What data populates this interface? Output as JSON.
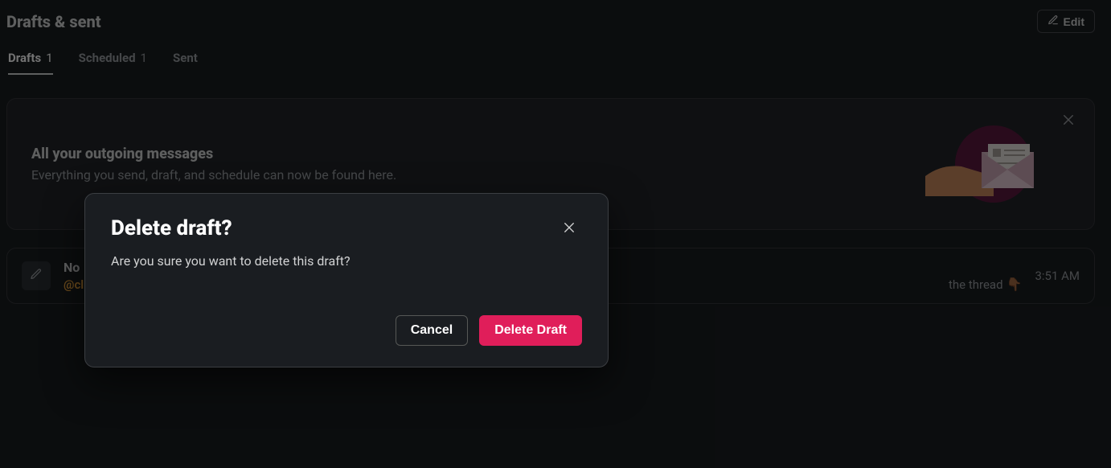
{
  "header": {
    "title": "Drafts & sent",
    "edit_label": "Edit"
  },
  "tabs": [
    {
      "label": "Drafts",
      "count": "1",
      "active": true
    },
    {
      "label": "Scheduled",
      "count": "1",
      "active": false
    },
    {
      "label": "Sent",
      "count": "",
      "active": false
    }
  ],
  "banner": {
    "title": "All your outgoing messages",
    "subtitle": "Everything you send, draft, and schedule can now be found here."
  },
  "draft": {
    "title_prefix": "No",
    "mention": "@cl",
    "snippet_tail": "the thread",
    "emoji": "👇🏾",
    "time": "3:51 AM"
  },
  "modal": {
    "title": "Delete draft?",
    "body": "Are you sure you want to delete this draft?",
    "cancel_label": "Cancel",
    "confirm_label": "Delete Draft"
  }
}
